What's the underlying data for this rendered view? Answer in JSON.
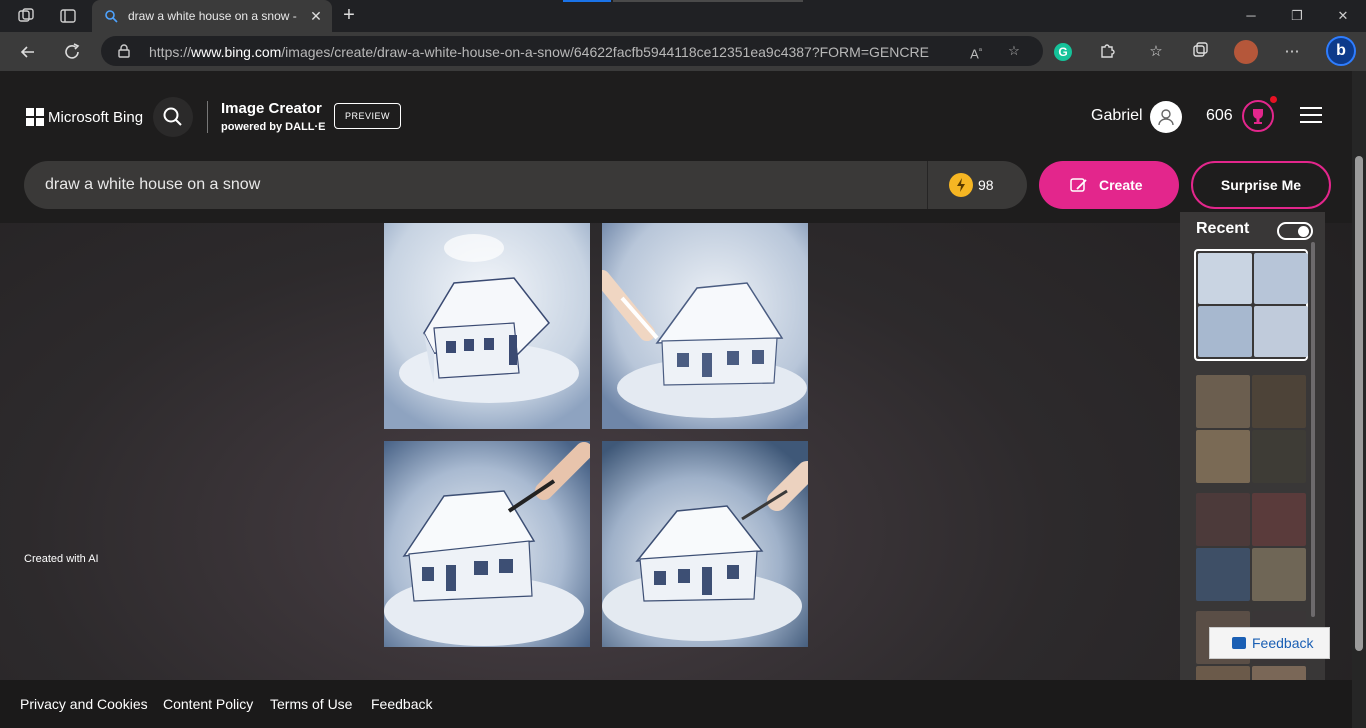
{
  "browser": {
    "tab_title": "draw a white house on a snow - Microsoft Bing",
    "url_prefix": "https://",
    "url_host": "www.bing.com",
    "url_path": "/images/create/draw-a-white-house-on-a-snow/64622facfb5944118ce12351ea9c4387?FORM=GENCRE",
    "new_tab": "+",
    "tab_close": "✕"
  },
  "header": {
    "brand": "Microsoft Bing",
    "product": "Image Creator",
    "powered_by": "powered by DALL·E",
    "badge": "PREVIEW",
    "username": "Gabriel",
    "points": "606"
  },
  "search": {
    "query": "draw a white house on a snow",
    "boosts": "98",
    "create_label": "Create",
    "surprise_label": "Surprise Me"
  },
  "main": {
    "created_with": "Created with AI",
    "images": [
      {
        "name": "house-sketch-1"
      },
      {
        "name": "house-sketch-2"
      },
      {
        "name": "house-sketch-3"
      },
      {
        "name": "house-sketch-4"
      }
    ]
  },
  "recent": {
    "title": "Recent",
    "groups": [
      {
        "name": "snow-house-set",
        "colors": [
          "#c9d4e2",
          "#b7c5d8",
          "#a7b8cf",
          "#c0cbdb"
        ]
      },
      {
        "name": "puppies-set",
        "colors": [
          "#6b5e4f",
          "#4d4338",
          "#7a6a55",
          "#3e3c36"
        ]
      },
      {
        "name": "boulder-set",
        "colors": [
          "#4c3a3a",
          "#5a3b3b",
          "#3e4f66",
          "#6f6656"
        ]
      },
      {
        "name": "boulder-set-2",
        "colors": [
          "#5a4e46",
          "#3a3637",
          "#6b5a4a",
          "#7a6757"
        ]
      }
    ]
  },
  "footer": {
    "links": [
      "Privacy and Cookies",
      "Content Policy",
      "Terms of Use",
      "Feedback"
    ],
    "feedback_button": "Feedback"
  },
  "colors": {
    "accent": "#e3268c",
    "boost": "#f6b623"
  }
}
